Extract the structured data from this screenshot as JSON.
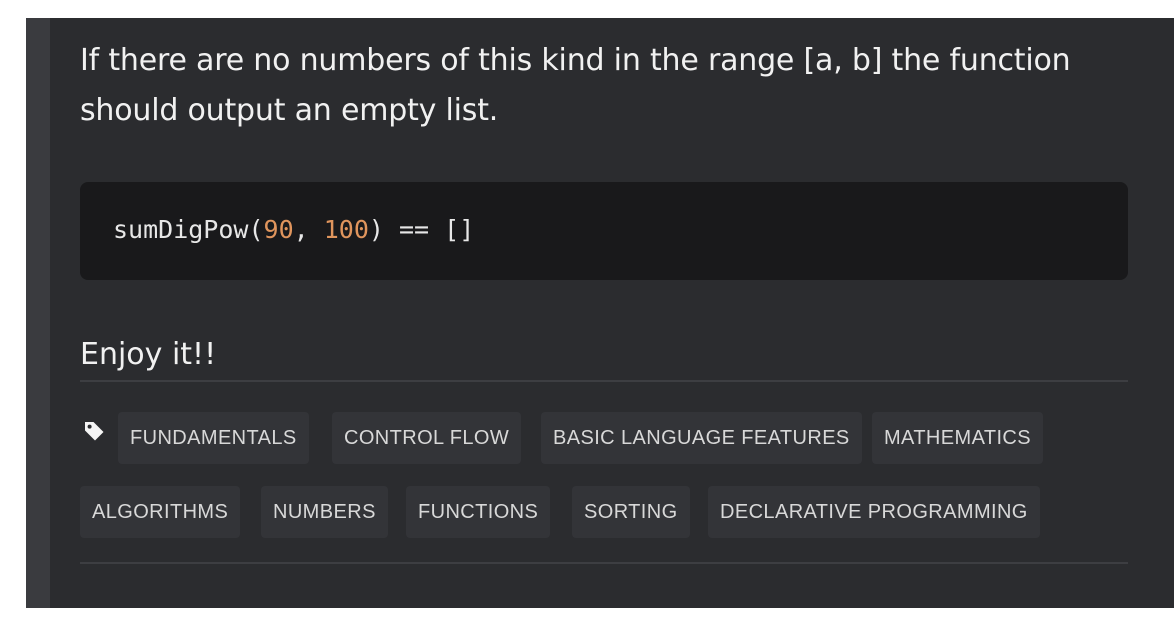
{
  "description": {
    "paragraph": "If there are no numbers of this kind in the range [a, b] the function should output an empty list.",
    "code": {
      "func": "sumDigPow(",
      "arg1": "90",
      "sep": ", ",
      "arg2": "100",
      "rest": ") == []"
    },
    "closing": "Enjoy it!!"
  },
  "tags": {
    "icon": "tag-icon",
    "items": [
      "FUNDAMENTALS",
      "CONTROL FLOW",
      "BASIC LANGUAGE FEATURES",
      "MATHEMATICS",
      "ALGORITHMS",
      "NUMBERS",
      "FUNCTIONS",
      "SORTING",
      "DECLARATIVE PROGRAMMING"
    ]
  },
  "colors": {
    "background": "#2b2c2f",
    "code_background": "#19191b",
    "number": "#e0955d",
    "tag_background": "#333438"
  }
}
